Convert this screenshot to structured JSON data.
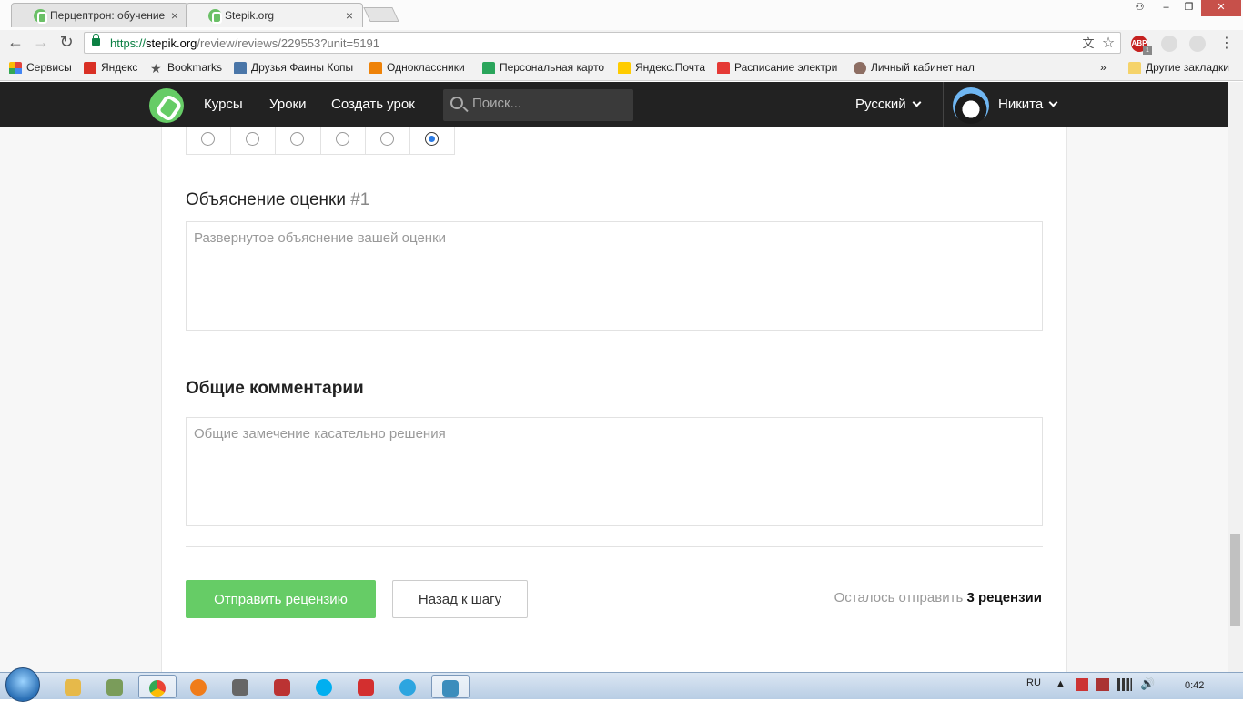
{
  "browser": {
    "tabs": [
      {
        "title": "Перцептрон: обучение",
        "close": "×"
      },
      {
        "title": "Stepik.org",
        "close": "×"
      }
    ],
    "window_controls": {
      "user": "⚇",
      "minimize": "–",
      "maximize": "❐",
      "close": "✕"
    },
    "url": {
      "scheme": "https://",
      "host": "stepik.org",
      "path": "/review/reviews/229553?unit=5191"
    },
    "nav": {
      "back": "←",
      "forward": "→",
      "reload": "↻"
    },
    "omni_icons": {
      "translate": "文",
      "star": "☆"
    },
    "extensions": {
      "abp": "ABP",
      "abp_count": "1",
      "menu": "⋮"
    },
    "bookmarks": [
      {
        "label": "Сервисы",
        "color": "#e3443c"
      },
      {
        "label": "Яндекс",
        "color": "#d93025"
      },
      {
        "label": "Bookmarks",
        "color": "#555555"
      },
      {
        "label": "Друзья Фаины Копы",
        "color": "#4a76a8"
      },
      {
        "label": "Одноклассники",
        "color": "#ee8208"
      },
      {
        "label": "Персональная карто",
        "color": "#2aa55b"
      },
      {
        "label": "Яндекс.Почта",
        "color": "#ffcc00"
      },
      {
        "label": "Расписание электри",
        "color": "#e53935"
      },
      {
        "label": "Личный кабинет нал",
        "color": "#8d6e63"
      }
    ],
    "bookmarks_more": "»",
    "other_bookmarks": "Другие закладки"
  },
  "stepik_nav": {
    "links": [
      "Курсы",
      "Уроки",
      "Создать урок"
    ],
    "search_placeholder": "Поиск...",
    "language": "Русский",
    "user": "Никита"
  },
  "review": {
    "scale_selected_index": 5,
    "scale_count": 6,
    "explanation_heading": "Объяснение оценки",
    "explanation_number": "#1",
    "explanation_placeholder": "Развернутое объяснение вашей оценки",
    "comments_heading": "Общие комментарии",
    "comments_placeholder": "Общие замечение касательно решения",
    "submit_label": "Отправить рецензию",
    "back_label": "Назад к шагу",
    "remaining_prefix": "Осталось отправить",
    "remaining_count": "3 рецензии"
  },
  "taskbar": {
    "lang": "RU",
    "time": "0:42",
    "apps": [
      {
        "name": "explorer",
        "color": "#e6b94a"
      },
      {
        "name": "recycle",
        "color": "#7a9c5a"
      },
      {
        "name": "chrome",
        "color": "#4285f4"
      },
      {
        "name": "app-orange",
        "color": "#f07c1a"
      },
      {
        "name": "calculator",
        "color": "#666666"
      },
      {
        "name": "abacus",
        "color": "#b33"
      },
      {
        "name": "skype",
        "color": "#00aff0"
      },
      {
        "name": "vivaldi",
        "color": "#d32f2f"
      },
      {
        "name": "telegram",
        "color": "#2ca5e0"
      },
      {
        "name": "paint",
        "color": "#3c8dbc"
      }
    ]
  }
}
